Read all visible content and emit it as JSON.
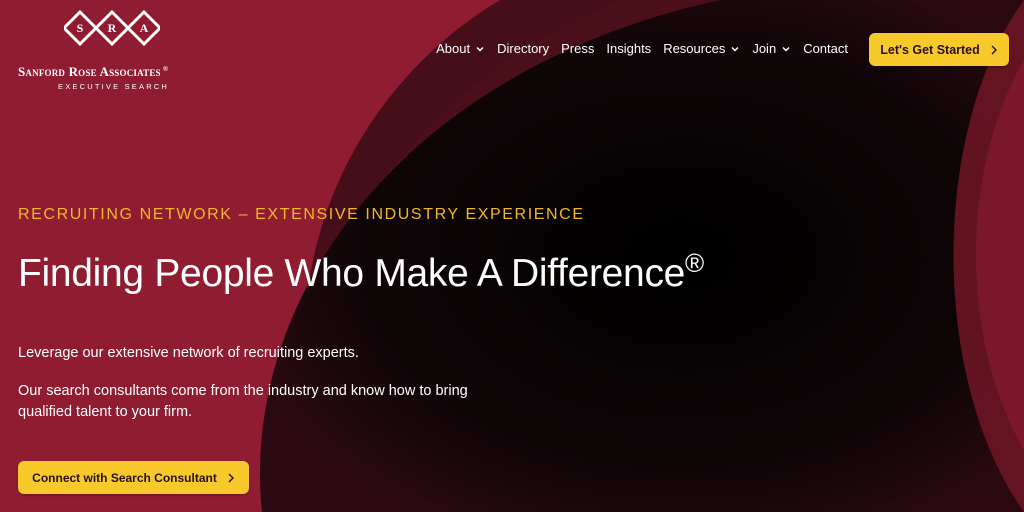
{
  "brand": {
    "letters": [
      "S",
      "R",
      "A"
    ],
    "name": "Sanford Rose Associates",
    "registered": "®",
    "tagline": "EXECUTIVE SEARCH"
  },
  "nav": {
    "items": [
      {
        "label": "About",
        "dropdown": true
      },
      {
        "label": "Directory",
        "dropdown": false
      },
      {
        "label": "Press",
        "dropdown": false
      },
      {
        "label": "Insights",
        "dropdown": false
      },
      {
        "label": "Resources",
        "dropdown": true
      },
      {
        "label": "Join",
        "dropdown": true
      },
      {
        "label": "Contact",
        "dropdown": false
      }
    ],
    "cta_label": "Let's Get Started"
  },
  "hero": {
    "eyebrow": "RECRUITING NETWORK – EXTENSIVE INDUSTRY EXPERIENCE",
    "headline": "Finding People Who Make A Difference",
    "headline_mark": "®",
    "paragraph1": "Leverage our extensive network of recruiting experts.",
    "paragraph2": "Our search consultants come from the industry and know how to bring qualified talent to your firm.",
    "cta_label": "Connect with Search Consultant"
  },
  "colors": {
    "background": "#8f1c30",
    "accent": "#f7c92a",
    "eyebrow": "#f2b72a",
    "dark": "#0a0607"
  }
}
